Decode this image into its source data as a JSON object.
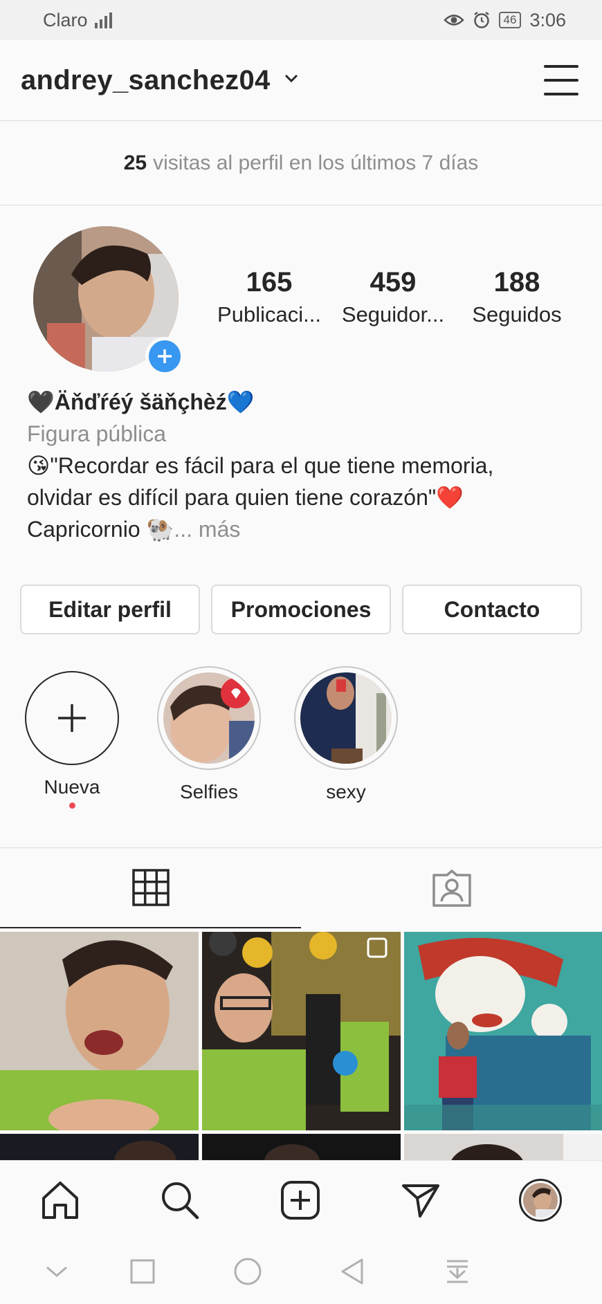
{
  "status_bar": {
    "carrier": "Claro",
    "battery": "46",
    "time": "3:06"
  },
  "header": {
    "username": "andrey_sanchez04"
  },
  "insights": {
    "count": "25",
    "text": "visitas al perfil en los últimos 7 días"
  },
  "stats": [
    {
      "value": "165",
      "label": "Publicaci..."
    },
    {
      "value": "459",
      "label": "Seguidor..."
    },
    {
      "value": "188",
      "label": "Seguidos"
    }
  ],
  "bio": {
    "name": "🖤Äňďŕéý šäňçhèź💙",
    "category": "Figura pública",
    "line1": "😘\"Recordar es fácil para el que tiene memoria,",
    "line2": "olvidar es difícil para quien tiene corazón\"❤️",
    "line3": "Capricornio 🐏",
    "more": "... más"
  },
  "buttons": {
    "edit": "Editar perfil",
    "promotions": "Promociones",
    "contact": "Contacto"
  },
  "highlights": [
    {
      "label": "Nueva"
    },
    {
      "label": "Selfies"
    },
    {
      "label": "sexy"
    }
  ],
  "icons": {
    "menu": "hamburger-icon",
    "new_highlight": "plus-icon",
    "grid_tab": "grid-icon",
    "tagged_tab": "tagged-person-icon",
    "home": "home-icon",
    "search": "search-icon",
    "create": "add-post-icon",
    "direct": "send-icon"
  },
  "colors": {
    "accent": "#3897f0",
    "notification_dot": "#ed4956",
    "text": "#262626",
    "muted": "#8e8e8e"
  }
}
